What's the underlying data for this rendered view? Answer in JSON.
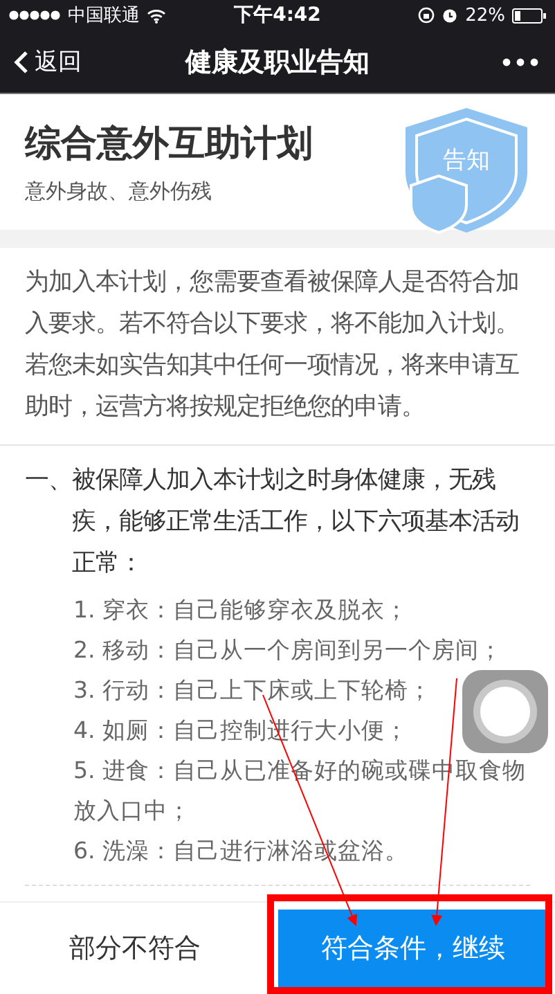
{
  "status_bar": {
    "carrier": "中国联通",
    "time": "下午4:42",
    "battery": "22%"
  },
  "nav": {
    "back": "返回",
    "title": "健康及职业告知"
  },
  "header": {
    "title": "综合意外互助计划",
    "subtitle": "意外身故、意外伤残",
    "badge": "告知"
  },
  "intro": "为加入本计划，您需要查看被保障人是否符合加入要求。若不符合以下要求，将不能加入计划。若您未如实告知其中任何一项情况，将来申请互助时，运营方将按规定拒绝您的申请。",
  "section": {
    "number": "一、",
    "heading": "被保障人加入本计划之时身体健康，无残疾，能够正常生活工作，以下六项基本活动正常：",
    "items": [
      "1. 穿衣：自己能够穿衣及脱衣；",
      "2. 移动：自己从一个房间到另一个房间；",
      "3. 行动：自己上下床或上下轮椅；",
      "4. 如厕：自己控制进行大小便；",
      "5. 进食：自己从已准备好的碗或碟中取食物放入口中；",
      "6. 洗澡：自己进行淋浴或盆浴。"
    ]
  },
  "buttons": [
    {
      "label": "部分不符合",
      "kind": "secondary"
    },
    {
      "label": "符合条件，继续",
      "kind": "primary"
    }
  ]
}
